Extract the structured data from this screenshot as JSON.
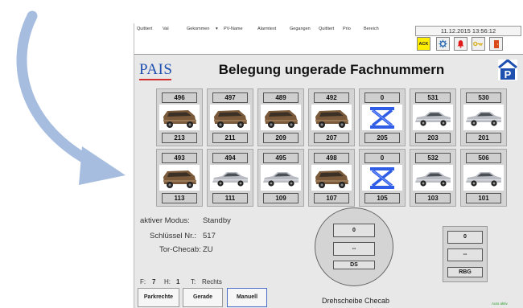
{
  "alarm_bar": {
    "columns": [
      "Quittiert",
      "Val",
      "Gekommen",
      "PV-Name",
      "Alarmtext",
      "Gegangen",
      "Quittiert",
      "Prio",
      "Bereich"
    ],
    "datetime": "11.12.2015 13:56:12",
    "ack_label": "ACK"
  },
  "header": {
    "logo": "PAIS",
    "title": "Belegung ungerade Fachnummern"
  },
  "grid": {
    "row1": [
      {
        "top": "496",
        "bottom": "213",
        "pic": "van"
      },
      {
        "top": "497",
        "bottom": "211",
        "pic": "van"
      },
      {
        "top": "489",
        "bottom": "209",
        "pic": "van"
      },
      {
        "top": "492",
        "bottom": "207",
        "pic": "van"
      },
      {
        "top": "0",
        "bottom": "205",
        "pic": "lift"
      },
      {
        "top": "531",
        "bottom": "203",
        "pic": "sedan"
      },
      {
        "top": "530",
        "bottom": "201",
        "pic": "sedan"
      }
    ],
    "row2": [
      {
        "top": "493",
        "bottom": "113",
        "pic": "van"
      },
      {
        "top": "494",
        "bottom": "111",
        "pic": "sedan"
      },
      {
        "top": "495",
        "bottom": "109",
        "pic": "sedan"
      },
      {
        "top": "498",
        "bottom": "107",
        "pic": "van"
      },
      {
        "top": "0",
        "bottom": "105",
        "pic": "lift"
      },
      {
        "top": "532",
        "bottom": "103",
        "pic": "sedan"
      },
      {
        "top": "506",
        "bottom": "101",
        "pic": "sedan"
      }
    ]
  },
  "status": {
    "mode_label": "aktiver Modus:",
    "mode_value": "Standby",
    "key_label": "Schlüssel Nr.:",
    "key_value": "517",
    "gate_label": "Tor-Checab:",
    "gate_value": "ZU",
    "f_label": "F:",
    "f_value": "7",
    "h_label": "H:",
    "h_value": "1",
    "t_label": "T:",
    "t_value": "Rechts"
  },
  "turntable": {
    "top_value": "0",
    "middle_value": "--",
    "label": "DS",
    "caption": "Drehscheibe Checab"
  },
  "rbg": {
    "top_value": "0",
    "middle_value": "--",
    "label": "RBG"
  },
  "buttons": {
    "parkrechte": "Parkrechte",
    "gerade": "Gerade",
    "manuell": "Manuell"
  },
  "footer": {
    "status": "Auto aktiv"
  },
  "colors": {
    "ack_yellow": "#ffee00",
    "logo_blue": "#1e50b0",
    "lift_blue": "#2f5de6",
    "van_brown": "#7a5a3a",
    "sedan_silver": "#b8bcc2",
    "arrow_blue": "#a7bde0"
  }
}
